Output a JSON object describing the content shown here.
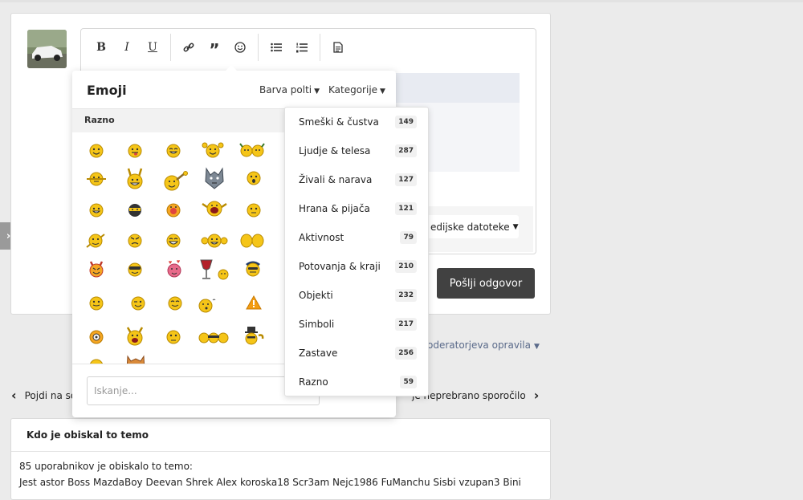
{
  "toolbar": {
    "bold": "B",
    "italic": "I",
    "underline": "U"
  },
  "editor": {
    "attach_label": "edijske datoteke",
    "send_label": "Pošlji odgovor"
  },
  "moderator": {
    "label": "oderatorjeva opravila"
  },
  "nav": {
    "prev_label": "Pojdi na so",
    "next_label": "je neprebrano sporočilo"
  },
  "visitors": {
    "title": "Kdo je obiskal to temo",
    "count_text": "85 uporabnikov je obiskalo to temo:",
    "names_text": "Jest  astor  Boss  MazdaBoy  Deevan  Shrek  Alex  koroska18  Scr3am  Nejc1986  FuManchu  Sisbi  vzupan3  Bini"
  },
  "emoji": {
    "title": "Emoji",
    "skin_label": "Barva polti",
    "category_label": "Kategorije",
    "section_label": "Razno",
    "search_placeholder": "Iskanje..."
  },
  "categories": [
    {
      "label": "Smeški & čustva",
      "count": "149"
    },
    {
      "label": "Ljudje & telesa",
      "count": "287"
    },
    {
      "label": "Živali & narava",
      "count": "127"
    },
    {
      "label": "Hrana & pijača",
      "count": "121"
    },
    {
      "label": "Aktivnost",
      "count": "79"
    },
    {
      "label": "Potovanja & kraji",
      "count": "210"
    },
    {
      "label": "Objekti",
      "count": "232"
    },
    {
      "label": "Simboli",
      "count": "217"
    },
    {
      "label": "Zastave",
      "count": "256"
    },
    {
      "label": "Razno",
      "count": "59"
    }
  ],
  "colors": {
    "send_button": "#414141",
    "smiley_yellow": "#f5c518",
    "link_blue": "#5a6a8a"
  }
}
